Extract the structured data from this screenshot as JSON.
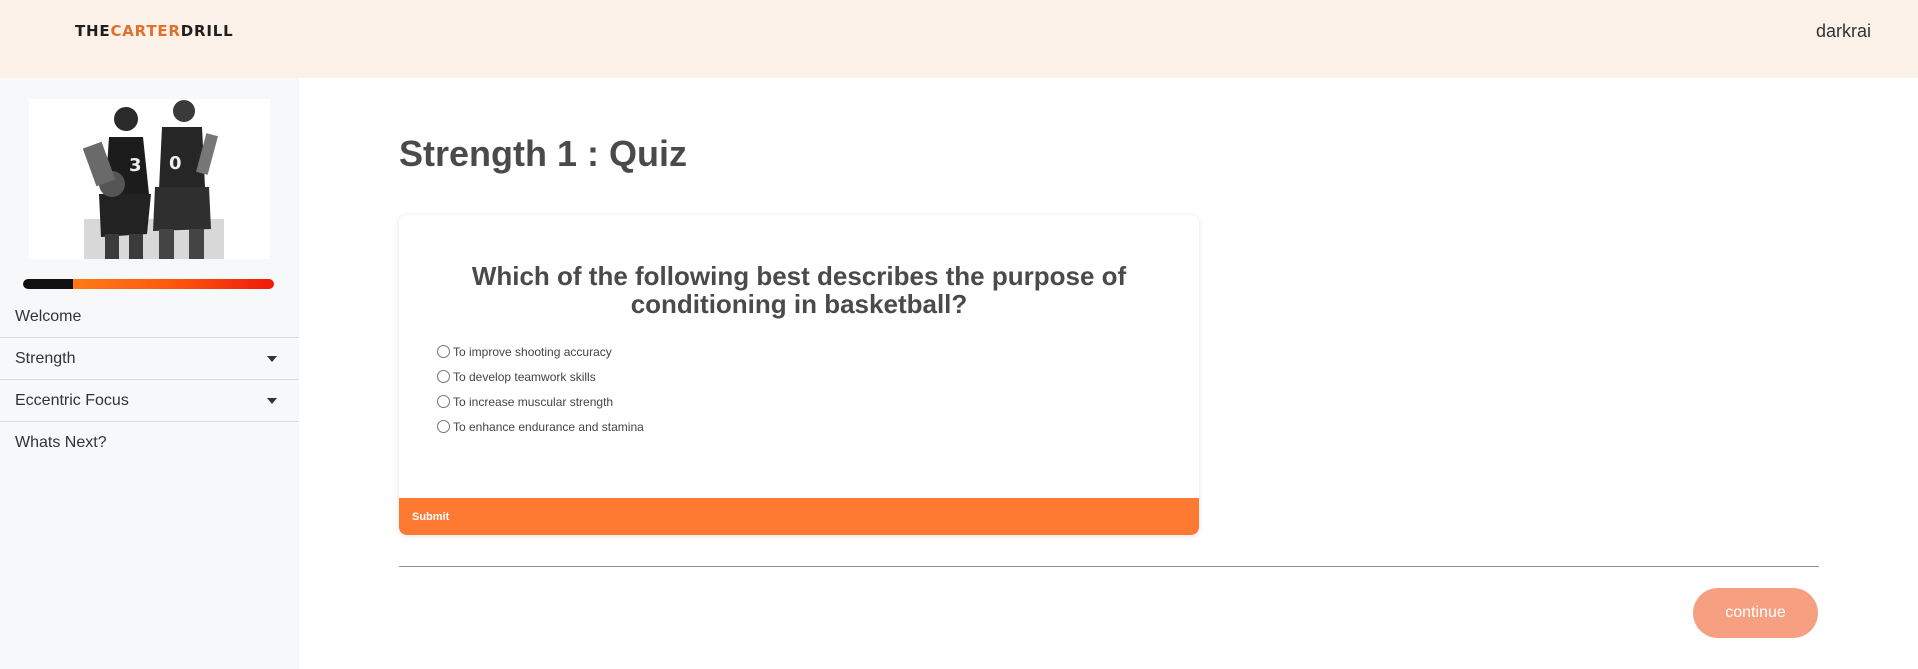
{
  "header": {
    "logo": {
      "part1": "THE",
      "part2": "CARTER",
      "part3": "DRILL"
    },
    "username": "darkrai"
  },
  "sidebar": {
    "progress_fraction": 0.2,
    "items": [
      {
        "label": "Welcome",
        "has_dropdown": false
      },
      {
        "label": "Strength",
        "has_dropdown": true
      },
      {
        "label": "Eccentric Focus",
        "has_dropdown": true
      },
      {
        "label": "Whats Next?",
        "has_dropdown": false
      }
    ]
  },
  "main": {
    "title": "Strength 1 : Quiz",
    "quiz": {
      "question": "Which of the following best describes the purpose of conditioning in basketball?",
      "options": [
        "To improve shooting accuracy",
        "To develop teamwork skills",
        "To increase muscular strength",
        "To enhance endurance and stamina"
      ],
      "submit_label": "Submit"
    },
    "continue_label": "continue"
  },
  "colors": {
    "header_bg": "#fcf1e8",
    "accent": "#fe7a33",
    "continue_bg": "#f7a081",
    "sidebar_bg": "#f7f8fa"
  }
}
